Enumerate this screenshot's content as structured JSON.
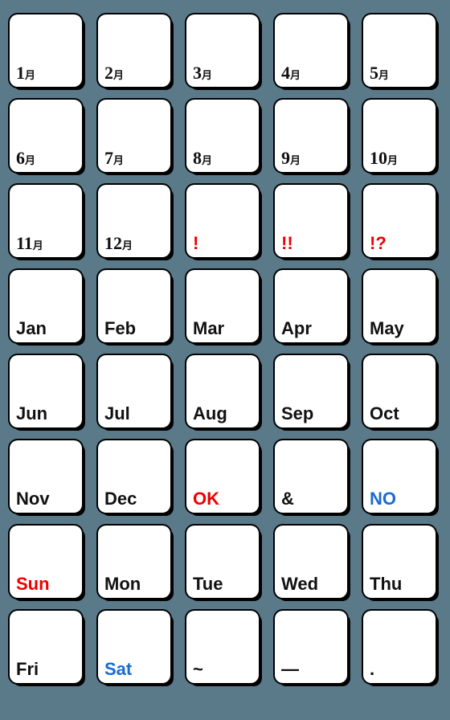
{
  "background": "#5a7a8a",
  "stickers": [
    {
      "id": "jan-jp",
      "display": "1月",
      "type": "kanji-num",
      "num": "1",
      "kanji": "月",
      "color": "black"
    },
    {
      "id": "feb-jp",
      "display": "2月",
      "type": "kanji-num",
      "num": "2",
      "kanji": "月",
      "color": "black"
    },
    {
      "id": "mar-jp",
      "display": "3月",
      "type": "kanji-num",
      "num": "3",
      "kanji": "月",
      "color": "black"
    },
    {
      "id": "apr-jp",
      "display": "4月",
      "type": "kanji-num",
      "num": "4",
      "kanji": "月",
      "color": "black"
    },
    {
      "id": "may-jp",
      "display": "5月",
      "type": "kanji-num",
      "num": "5",
      "kanji": "月",
      "color": "black"
    },
    {
      "id": "jun-jp",
      "display": "6月",
      "type": "kanji-num",
      "num": "6",
      "kanji": "月",
      "color": "black"
    },
    {
      "id": "jul-jp",
      "display": "7月",
      "type": "kanji-num",
      "num": "7",
      "kanji": "月",
      "color": "black"
    },
    {
      "id": "aug-jp",
      "display": "8月",
      "type": "kanji-num",
      "num": "8",
      "kanji": "月",
      "color": "black"
    },
    {
      "id": "sep-jp",
      "display": "9月",
      "type": "kanji-num",
      "num": "9",
      "kanji": "月",
      "color": "black"
    },
    {
      "id": "oct-jp",
      "display": "10月",
      "type": "kanji-num",
      "num": "10",
      "kanji": "月",
      "color": "black"
    },
    {
      "id": "nov-jp",
      "display": "11月",
      "type": "kanji-num",
      "num": "11",
      "kanji": "月",
      "color": "black"
    },
    {
      "id": "dec-jp",
      "display": "12月",
      "type": "kanji-num",
      "num": "12",
      "kanji": "月",
      "color": "black"
    },
    {
      "id": "exclaim1",
      "display": "!",
      "type": "plain",
      "color": "red"
    },
    {
      "id": "exclaim2",
      "display": "!!",
      "type": "plain",
      "color": "red"
    },
    {
      "id": "exclaim-q",
      "display": "!?",
      "type": "plain",
      "color": "red"
    },
    {
      "id": "jan-en",
      "display": "Jan",
      "type": "plain",
      "color": "black"
    },
    {
      "id": "feb-en",
      "display": "Feb",
      "type": "plain",
      "color": "black"
    },
    {
      "id": "mar-en",
      "display": "Mar",
      "type": "plain",
      "color": "black"
    },
    {
      "id": "apr-en",
      "display": "Apr",
      "type": "plain",
      "color": "black"
    },
    {
      "id": "may-en",
      "display": "May",
      "type": "plain",
      "color": "black"
    },
    {
      "id": "jun-en",
      "display": "Jun",
      "type": "plain",
      "color": "black"
    },
    {
      "id": "jul-en",
      "display": "Jul",
      "type": "plain",
      "color": "black"
    },
    {
      "id": "aug-en",
      "display": "Aug",
      "type": "plain",
      "color": "black"
    },
    {
      "id": "sep-en",
      "display": "Sep",
      "type": "plain",
      "color": "black"
    },
    {
      "id": "oct-en",
      "display": "Oct",
      "type": "plain",
      "color": "black"
    },
    {
      "id": "nov-en",
      "display": "Nov",
      "type": "plain",
      "color": "black"
    },
    {
      "id": "dec-en",
      "display": "Dec",
      "type": "plain",
      "color": "black"
    },
    {
      "id": "ok",
      "display": "OK",
      "type": "plain",
      "color": "red"
    },
    {
      "id": "ampersand",
      "display": "&",
      "type": "plain",
      "color": "black"
    },
    {
      "id": "no",
      "display": "NO",
      "type": "plain",
      "color": "blue"
    },
    {
      "id": "sun",
      "display": "Sun",
      "type": "plain",
      "color": "red"
    },
    {
      "id": "mon",
      "display": "Mon",
      "type": "plain",
      "color": "black"
    },
    {
      "id": "tue",
      "display": "Tue",
      "type": "plain",
      "color": "black"
    },
    {
      "id": "wed",
      "display": "Wed",
      "type": "plain",
      "color": "black"
    },
    {
      "id": "thu",
      "display": "Thu",
      "type": "plain",
      "color": "black"
    },
    {
      "id": "fri",
      "display": "Fri",
      "type": "plain",
      "color": "black"
    },
    {
      "id": "sat",
      "display": "Sat",
      "type": "plain",
      "color": "blue"
    },
    {
      "id": "tilde",
      "display": "~",
      "type": "plain",
      "color": "black"
    },
    {
      "id": "dash",
      "display": "—",
      "type": "plain",
      "color": "black"
    },
    {
      "id": "dot",
      "display": ".",
      "type": "plain",
      "color": "black"
    }
  ]
}
